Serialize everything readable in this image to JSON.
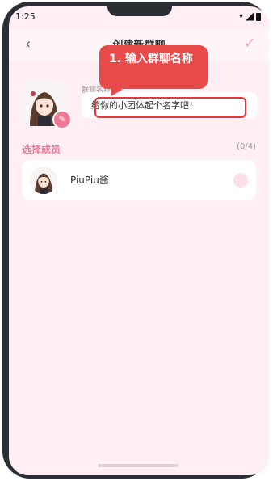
{
  "status": {
    "time": "1:25"
  },
  "header": {
    "title": "创建新群聊"
  },
  "group": {
    "name_label": "群聊名称",
    "name_placeholder": "给你的小团体起个名字吧！"
  },
  "callout": {
    "text": "1. 输入群聊名称"
  },
  "members": {
    "section_title": "选择成员",
    "count": "(0/4)",
    "items": [
      {
        "name": "PiuPiu酱"
      }
    ]
  },
  "colors": {
    "accent": "#f07896",
    "callout": "#e84a4a",
    "background": "#ffeef3"
  }
}
